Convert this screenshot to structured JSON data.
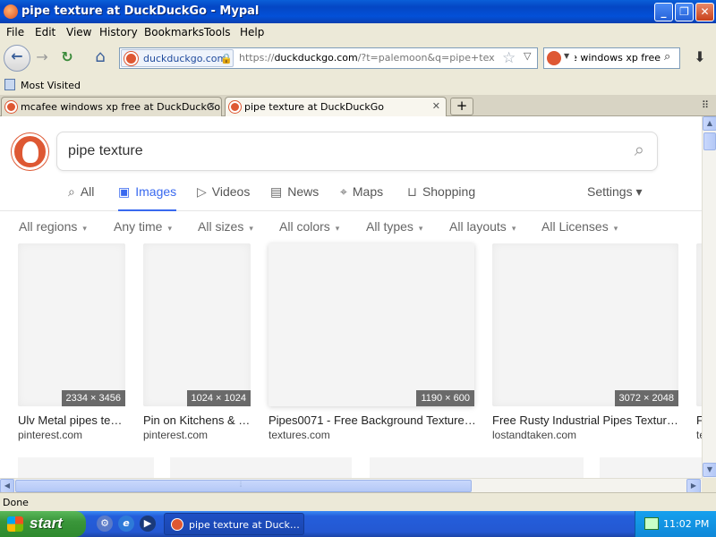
{
  "window": {
    "title": "pipe texture at DuckDuckGo - Mypal",
    "minimize": "_",
    "maximize": "❐",
    "close": "✕"
  },
  "menu": [
    "File",
    "Edit",
    "View",
    "History",
    "Bookmarks",
    "Tools",
    "Help"
  ],
  "nav": {
    "back": "←",
    "forward": "→",
    "reload": "↻",
    "home": "⌂",
    "identity_domain": "duckduckgo.com",
    "lock": "🔒",
    "url_prefix": "https://",
    "url_host": "duckduckgo.com",
    "url_rest": "/?t=palemoon&q=pipe+texture&ia>",
    "star": "☆",
    "url_dropdown": "▽",
    "search_value": "ee windows xp free",
    "search_dropdown": "▼",
    "search_icon": "⌕",
    "download": "⬇"
  },
  "bookmarks": {
    "label": "Most Visited"
  },
  "tabs": [
    {
      "label": "mcafee windows xp free at DuckDuckGo",
      "close": "✕",
      "active": false
    },
    {
      "label": "pipe texture at DuckDuckGo",
      "close": "✕",
      "active": true
    }
  ],
  "new_tab": "+",
  "tab_list": "⠿",
  "ddg": {
    "query": "pipe texture",
    "search_icon": "⌕",
    "tabs": [
      {
        "icon": "⌕",
        "label": "All"
      },
      {
        "icon": "▣",
        "label": "Images"
      },
      {
        "icon": "▷",
        "label": "Videos"
      },
      {
        "icon": "▤",
        "label": "News"
      },
      {
        "icon": "⌖",
        "label": "Maps"
      },
      {
        "icon": "⊔",
        "label": "Shopping"
      }
    ],
    "settings": "Settings ▾",
    "filters": [
      "All regions",
      "Any time",
      "All sizes",
      "All colors",
      "All types",
      "All layouts",
      "All Licenses"
    ],
    "filter_caret": "▾",
    "results": [
      {
        "dims": "2334 × 3456",
        "title": "Ulv Metal pipes tex…",
        "source": "pinterest.com"
      },
      {
        "dims": "1024 × 1024",
        "title": "Pin on Kitchens & C…",
        "source": "pinterest.com"
      },
      {
        "dims": "1190 × 600",
        "title": "Pipes0071 - Free Background Texture …",
        "source": "textures.com"
      },
      {
        "dims": "3072 × 2048",
        "title": "Free Rusty Industrial Pipes Texture…",
        "source": "lostandtaken.com"
      },
      {
        "title": "F",
        "source": "te"
      }
    ]
  },
  "scroll": {
    "up": "▲",
    "down": "▼",
    "left": "◀",
    "right": "▶",
    "grip": "⦙"
  },
  "status": "Done",
  "taskbar": {
    "start": "start",
    "task_label": "pipe texture at Duck…",
    "clock": "11:02 PM",
    "quicklaunch": [
      "⚙",
      "e",
      "▶"
    ]
  }
}
